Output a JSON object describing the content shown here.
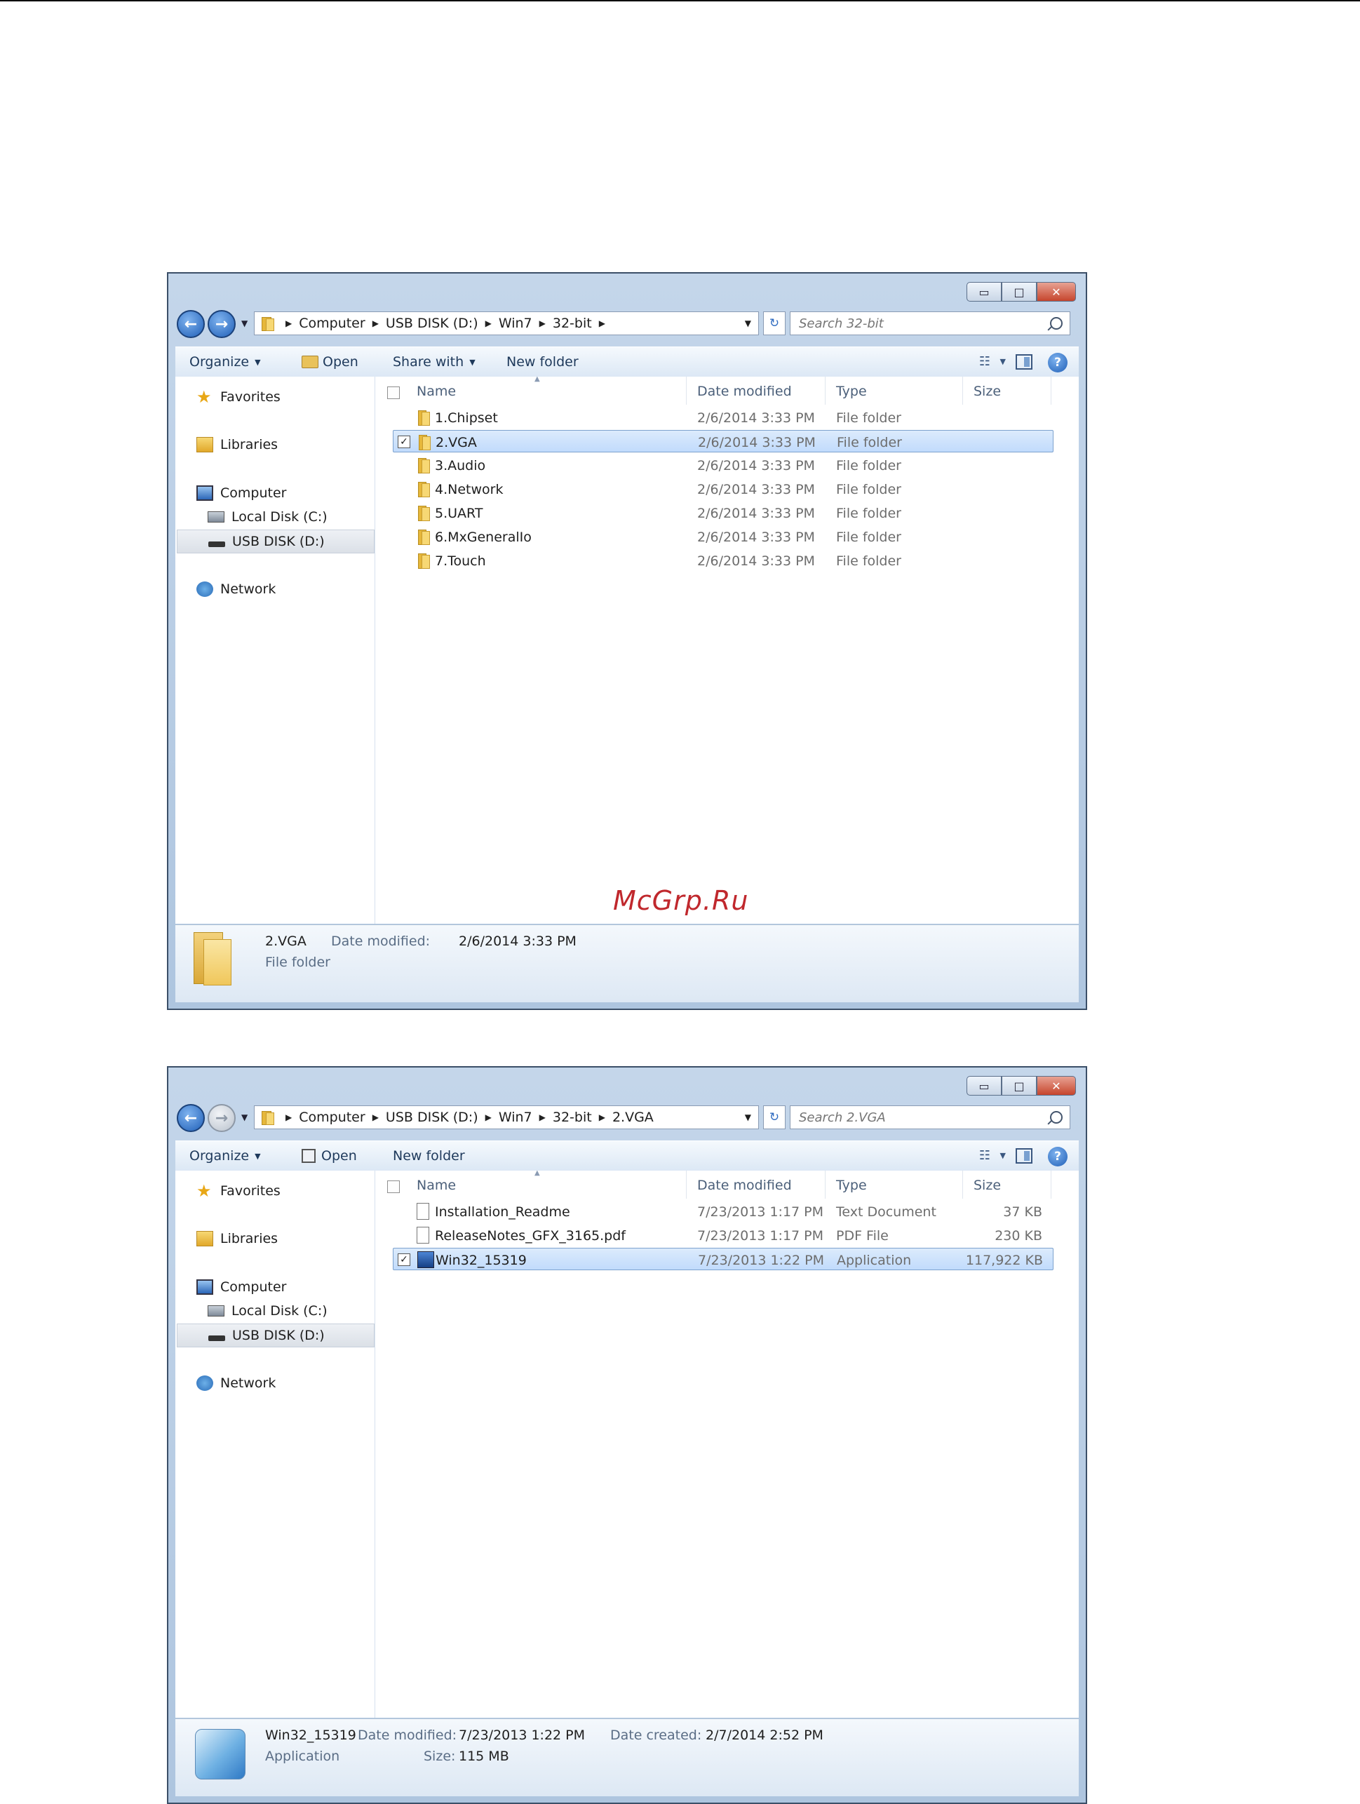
{
  "watermark": "McGrp.Ru",
  "window1": {
    "breadcrumb": [
      "Computer",
      "USB DISK (D:)",
      "Win7",
      "32-bit"
    ],
    "search_placeholder": "Search 32-bit",
    "toolbar": {
      "organize": "Organize",
      "open": "Open",
      "share": "Share with",
      "new_folder": "New folder"
    },
    "nav": {
      "favorites": "Favorites",
      "libraries": "Libraries",
      "computer": "Computer",
      "local_disk": "Local Disk (C:)",
      "usb_disk": "USB DISK (D:)",
      "network": "Network"
    },
    "columns": {
      "name": "Name",
      "date": "Date modified",
      "type": "Type",
      "size": "Size"
    },
    "files": [
      {
        "name": "1.Chipset",
        "date": "2/6/2014 3:33 PM",
        "type": "File folder",
        "size": ""
      },
      {
        "name": "2.VGA",
        "date": "2/6/2014 3:33 PM",
        "type": "File folder",
        "size": ""
      },
      {
        "name": "3.Audio",
        "date": "2/6/2014 3:33 PM",
        "type": "File folder",
        "size": ""
      },
      {
        "name": "4.Network",
        "date": "2/6/2014 3:33 PM",
        "type": "File folder",
        "size": ""
      },
      {
        "name": "5.UART",
        "date": "2/6/2014 3:33 PM",
        "type": "File folder",
        "size": ""
      },
      {
        "name": "6.MxGeneralIo",
        "date": "2/6/2014 3:33 PM",
        "type": "File folder",
        "size": ""
      },
      {
        "name": "7.Touch",
        "date": "2/6/2014 3:33 PM",
        "type": "File folder",
        "size": ""
      }
    ],
    "details": {
      "name": "2.VGA",
      "date_label": "Date modified:",
      "date_value": "2/6/2014 3:33 PM",
      "type": "File folder"
    }
  },
  "window2": {
    "breadcrumb": [
      "Computer",
      "USB DISK (D:)",
      "Win7",
      "32-bit",
      "2.VGA"
    ],
    "search_placeholder": "Search 2.VGA",
    "toolbar": {
      "organize": "Organize",
      "open": "Open",
      "new_folder": "New folder"
    },
    "nav": {
      "favorites": "Favorites",
      "libraries": "Libraries",
      "computer": "Computer",
      "local_disk": "Local Disk (C:)",
      "usb_disk": "USB DISK (D:)",
      "network": "Network"
    },
    "columns": {
      "name": "Name",
      "date": "Date modified",
      "type": "Type",
      "size": "Size"
    },
    "files": [
      {
        "name": "Installation_Readme",
        "date": "7/23/2013 1:17 PM",
        "type": "Text Document",
        "size": "37 KB"
      },
      {
        "name": "ReleaseNotes_GFX_3165.pdf",
        "date": "7/23/2013 1:17 PM",
        "type": "PDF File",
        "size": "230 KB"
      },
      {
        "name": "Win32_15319",
        "date": "7/23/2013 1:22 PM",
        "type": "Application",
        "size": "117,922 KB"
      }
    ],
    "details": {
      "name": "Win32_15319",
      "date_label": "Date modified:",
      "date_value": "7/23/2013 1:22 PM",
      "created_label": "Date created:",
      "created_value": "2/7/2014 2:52 PM",
      "type": "Application",
      "size_label": "Size:",
      "size_value": "115 MB"
    }
  }
}
